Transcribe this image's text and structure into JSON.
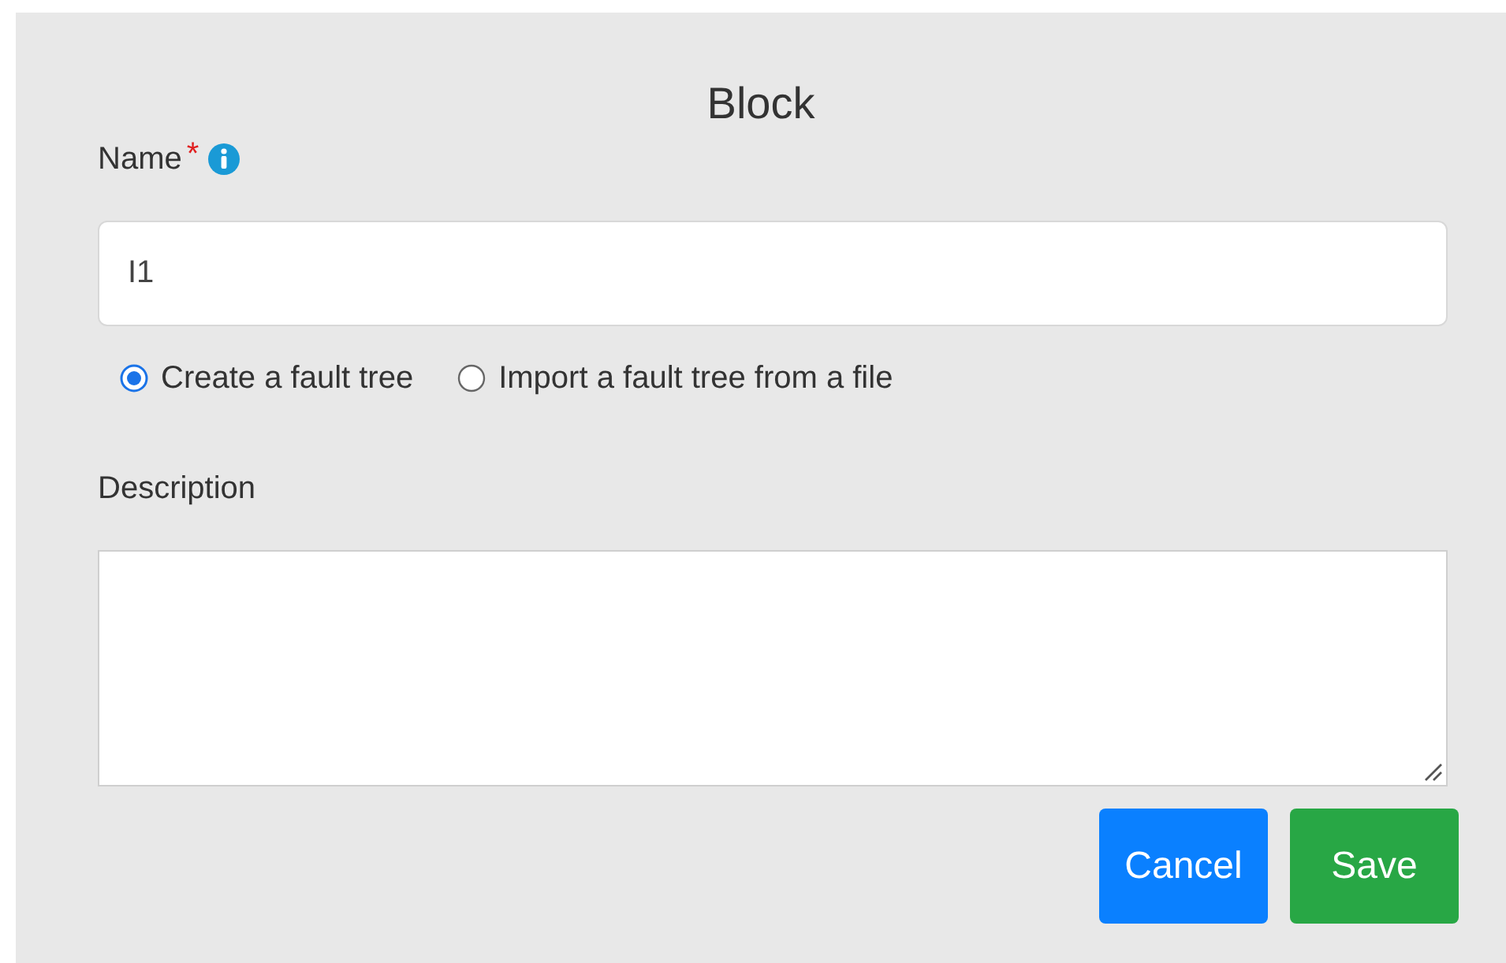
{
  "dialog": {
    "title": "Block"
  },
  "name_field": {
    "label": "Name",
    "required_mark": "*",
    "value": "I1"
  },
  "source_options": [
    {
      "label": "Create a fault tree",
      "selected": true
    },
    {
      "label": "Import a fault tree from a file",
      "selected": false
    }
  ],
  "description_field": {
    "label": "Description"
  },
  "buttons": [
    {
      "label": "Cancel",
      "kind": "cancel"
    },
    {
      "label": "Save",
      "kind": "save"
    }
  ]
}
